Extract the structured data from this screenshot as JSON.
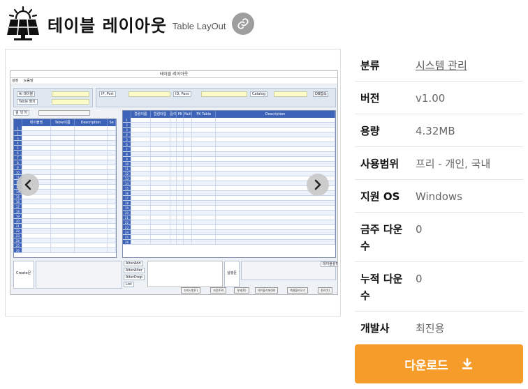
{
  "header": {
    "title": "테이블 레이아웃",
    "subtitle": "Table LayOut"
  },
  "screenshot": {
    "window_title": "테이블 레이아웃",
    "menu": [
      "설정",
      "도움말"
    ],
    "labels": {
      "ai_code": "AI 테이블",
      "table_name": "Table 정의",
      "ip_port": "IP, Port",
      "id_pass": "ID, Pass",
      "catalog": "Catalog",
      "connect": "DB접속",
      "search": "검 색 어",
      "create": "Create문",
      "alter_add": "AlterAdd",
      "alter_alter": "AlterAlter",
      "alter_drop": "AlterDrop",
      "list": "List",
      "exec": "실행문",
      "exec2": "테이블설명"
    },
    "left_grid_headers": [
      "테이블명",
      "Table이름",
      "Description",
      "Se"
    ],
    "right_grid_headers": [
      "컬럼이름",
      "컬럼타입",
      "길이",
      "PK",
      "Null",
      "FK Table",
      "Description"
    ],
    "row_numbers": [
      "1",
      "2",
      "3",
      "4",
      "5",
      "6",
      "7",
      "8",
      "9",
      "10",
      "11",
      "12",
      "13",
      "14",
      "15",
      "16",
      "17",
      "18",
      "19",
      "20",
      "21",
      "22",
      "23",
      "24",
      "25",
      "26"
    ],
    "bottom_buttons": [
      "조회사항(F)",
      "저장(F9)",
      "삭제(D)",
      "테이블삭제(W)",
      "엑셀불러오기",
      "종료(X)"
    ]
  },
  "info": {
    "rows": [
      {
        "key": "분류",
        "value": "시스템 관리"
      },
      {
        "key": "버전",
        "value": "v1.00"
      },
      {
        "key": "용량",
        "value": "4.32MB"
      },
      {
        "key": "사용범위",
        "value": "프리 - 개인, 국내"
      },
      {
        "key": "지원 OS",
        "value": "Windows"
      },
      {
        "key": "금주 다운수",
        "value": "0"
      },
      {
        "key": "누적 다운수",
        "value": "0"
      },
      {
        "key": "개발사",
        "value": "최진용"
      }
    ]
  },
  "download_label": "다운로드",
  "colors": {
    "download_bg": "#f59c2b",
    "grid_header": "#3d63b8",
    "link_button_bg": "#9e9e9e"
  }
}
